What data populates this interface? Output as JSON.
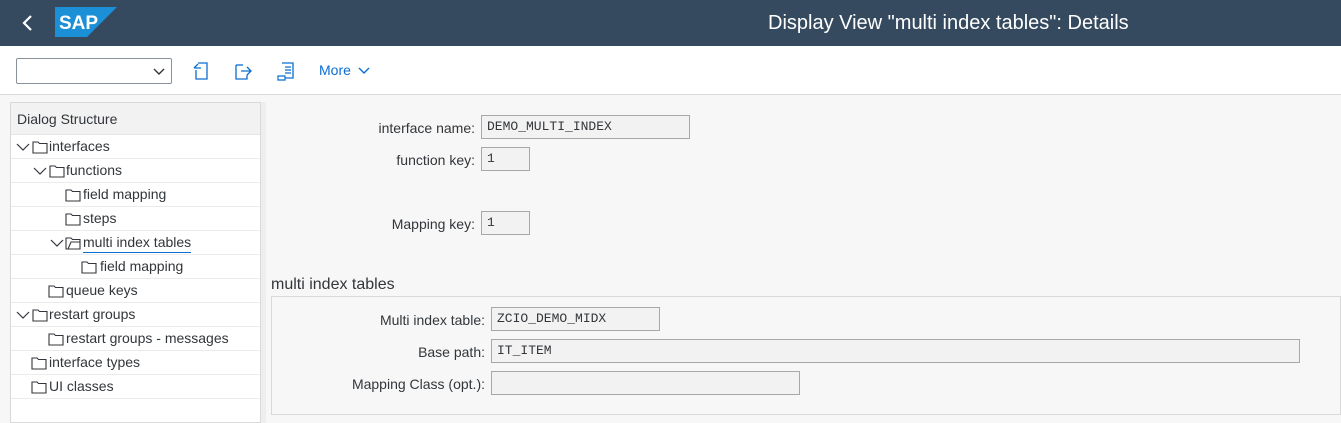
{
  "shell": {
    "title": "Display View \"multi index tables\": Details",
    "logo_text": "SAP"
  },
  "toolbar": {
    "command_field_value": "",
    "more_label": "More"
  },
  "dialog_structure": {
    "header": "Dialog Structure",
    "items": [
      {
        "label": "interfaces"
      },
      {
        "label": "functions"
      },
      {
        "label": "field mapping"
      },
      {
        "label": "steps"
      },
      {
        "label": "multi index tables"
      },
      {
        "label": "field mapping"
      },
      {
        "label": "queue keys"
      },
      {
        "label": "restart groups"
      },
      {
        "label": "restart groups - messages"
      },
      {
        "label": "interface types"
      },
      {
        "label": "UI classes"
      }
    ]
  },
  "header_fields": {
    "interface_name": {
      "label": "interface name:",
      "value": "DEMO_MULTI_INDEX"
    },
    "function_key": {
      "label": "function key:",
      "value": "1"
    },
    "mapping_key": {
      "label": "Mapping key:",
      "value": "1"
    }
  },
  "section": {
    "title": "multi index tables",
    "multi_index_table": {
      "label": "Multi index table:",
      "value": "ZCIO_DEMO_MIDX"
    },
    "base_path": {
      "label": "Base path:",
      "value": "IT_ITEM"
    },
    "mapping_class": {
      "label": "Mapping Class (opt.):",
      "value": ""
    }
  },
  "colors": {
    "shell_bg": "#354a5f",
    "accent": "#0a6ed1"
  }
}
